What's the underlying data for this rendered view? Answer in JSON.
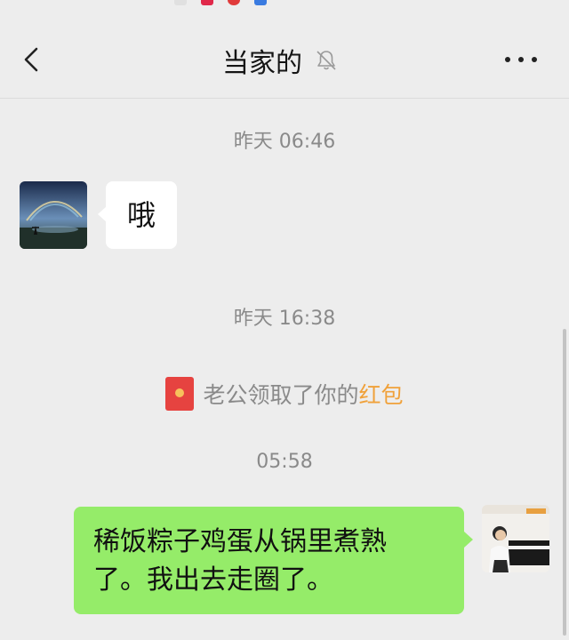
{
  "header": {
    "title": "当家的",
    "back_icon": "chevron-left-icon",
    "mute_icon": "bell-off-icon",
    "more_icon": "more-horizontal-icon"
  },
  "messages": [
    {
      "kind": "timestamp",
      "text": "昨天 06:46"
    },
    {
      "kind": "incoming",
      "text": "哦"
    },
    {
      "kind": "timestamp",
      "text": "昨天 16:38"
    },
    {
      "kind": "system",
      "prefix": "老公领取了你的",
      "link": "红包",
      "icon": "red-packet-icon"
    },
    {
      "kind": "timestamp",
      "text": "05:58"
    },
    {
      "kind": "outgoing",
      "lines": [
        "稀饭粽子鸡蛋从锅里煮熟",
        "了。我出去走圈了。"
      ]
    }
  ],
  "colors": {
    "background": "#ededed",
    "outgoing_bubble": "#95ec69",
    "incoming_bubble": "#ffffff",
    "link": "#f0a13a",
    "red_packet": "#e64340"
  }
}
